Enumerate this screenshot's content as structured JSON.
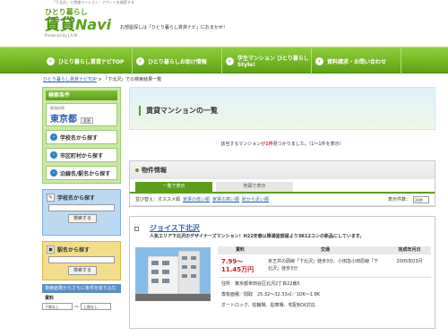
{
  "header": {
    "top_note": "「下北沢」で賃貸マンション・アパートを検索する",
    "logo_top": "ひとり暮らし",
    "logo_main": "賃貸",
    "logo_navi": "Navi",
    "logo_sub": "Produced by J.A.M",
    "tagline": "お部屋探しは「ひとり暮らし賃貸ナビ」におまかせ！"
  },
  "nav": {
    "items": [
      {
        "label": "ひとり暮らし賃貸ナビTOP"
      },
      {
        "label": "ひとり暮らしお助け情報"
      },
      {
        "label": "学生マンション ひとり暮らしStyle!"
      },
      {
        "label": "資料請求・お問い合わせ"
      }
    ]
  },
  "breadcrumb": {
    "home": "ひとり暮らし賃貸ナビTOP",
    "sep": " > ",
    "current": "「下北沢」での検索結果一覧"
  },
  "sidebar": {
    "head": "検索条件",
    "pref_label": "都道府県",
    "pref_value": "東京都",
    "pref_change": "変更",
    "buttons": [
      "学校名から探す",
      "市区町村から探す",
      "沿線名/駅名から探す"
    ],
    "school_title": "学校名から探す",
    "school_btn": "検索する",
    "station_title": "駅名から探す",
    "station_btn": "検索する",
    "cond_bar": "検索結果からさらに条件を絞り込む",
    "rent_label": "賃料",
    "rent_min": "下限なし",
    "rent_sep": "〜",
    "rent_max": "上限なし"
  },
  "main": {
    "title": "賃貸マンションの一覧",
    "count_pre": "該当するマンションが",
    "count_num": "1件",
    "count_post": "見つかりました。（1〜1件を表示）",
    "info_head": "物件情報",
    "tab_list": "一覧で表示",
    "tab_map": "地図で表示",
    "sort_label": "並び替え：オススメ順",
    "sort_links": [
      "家賃の低い順",
      "家賃の高い順",
      "駅から近い順"
    ],
    "perpage_label": "表示件数：",
    "perpage_value": "20件"
  },
  "property": {
    "name": "ジョイス下北沢",
    "desc": "人気エリア下北沢のデザイナーズマンション！H22年春以降満室部屋より3K12コンの新品にしています。",
    "col_rent": "賃料",
    "col_traffic": "交通",
    "col_built": "完成年月日",
    "price": "7.99〜11.45万円",
    "traffic": "京王井の頭線「下北沢」徒歩3分、小田急小田原線「下北沢」徒歩3分",
    "built": "2005年03月",
    "address_line": "住所　東京都世田谷区北沢2丁目22番5",
    "area_line": "専有面積／間取　25.32〜32.33㎡／1DK〜1.8K",
    "features": "オートロック、駐輪場、駐車場、宅配BOX対応"
  }
}
